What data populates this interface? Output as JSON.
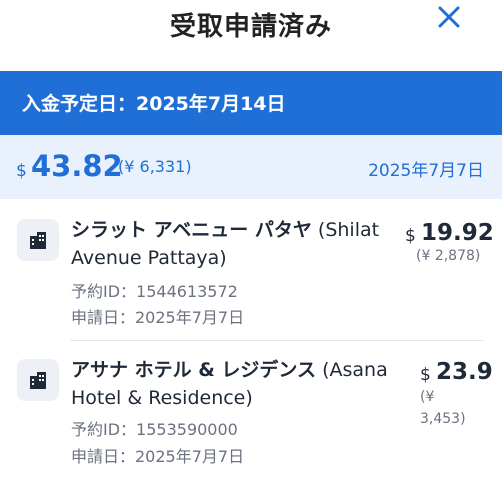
{
  "header": {
    "title": "受取申請済み"
  },
  "banner": {
    "payment_date": "入金予定日：2025年7月14日"
  },
  "summary": {
    "currency_symbol": "$",
    "amount": "43.82",
    "yen": "(¥ 6,331)",
    "date": "2025年7月7日"
  },
  "items": [
    {
      "name_jp": "シラット アベニュー パタヤ",
      "name_en_line1": "(Shilat",
      "name_en_line2": "Avenue Pattaya)",
      "booking_id": "予約ID：1544613572",
      "applied_date": "申請日：2025年7月7日",
      "currency_symbol": "$",
      "amount": "19.92",
      "yen": "(¥ 2,878)"
    },
    {
      "name_jp": "アサナ ホテル & レジデンス",
      "name_en_line1": "(Asana",
      "name_en_line2": "Hotel & Residence)",
      "booking_id": "予約ID：1553590000",
      "applied_date": "申請日：2025年7月7日",
      "currency_symbol": "$",
      "amount": "23.9",
      "yen_line1": "(¥",
      "yen_line2": "3,453)"
    }
  ],
  "colors": {
    "accent": "#1f6fd6",
    "summary_bg": "#e9f1fc",
    "icon_bg": "#edf0f4"
  },
  "icons": {
    "close": "close-icon",
    "hotel": "building-icon"
  }
}
